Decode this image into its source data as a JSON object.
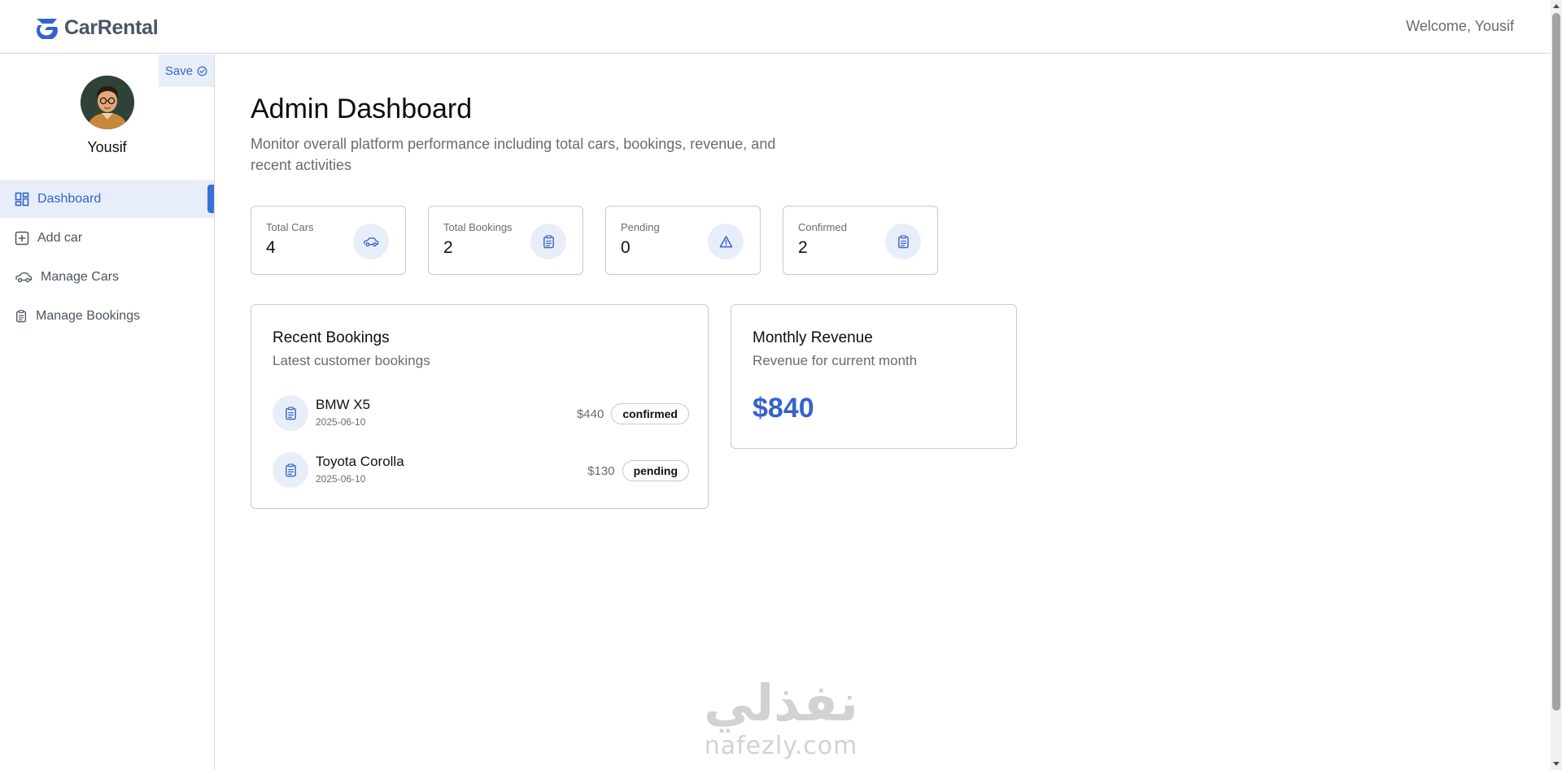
{
  "header": {
    "logo_text": "CarRental",
    "welcome": "Welcome, Yousif"
  },
  "sidebar": {
    "save_label": "Save",
    "user_name": "Yousif",
    "items": [
      {
        "label": "Dashboard",
        "icon": "dashboard-icon",
        "active": true
      },
      {
        "label": "Add car",
        "icon": "plus-square-icon",
        "active": false
      },
      {
        "label": "Manage Cars",
        "icon": "car-icon",
        "active": false
      },
      {
        "label": "Manage Bookings",
        "icon": "clipboard-icon",
        "active": false
      }
    ]
  },
  "main": {
    "title": "Admin Dashboard",
    "subtitle": "Monitor overall platform performance including total cars, bookings, revenue, and recent activities",
    "stats": [
      {
        "label": "Total Cars",
        "value": "4",
        "icon": "car-icon"
      },
      {
        "label": "Total Bookings",
        "value": "2",
        "icon": "clipboard-icon"
      },
      {
        "label": "Pending",
        "value": "0",
        "icon": "warning-icon"
      },
      {
        "label": "Confirmed",
        "value": "2",
        "icon": "clipboard-icon"
      }
    ],
    "recent_bookings": {
      "title": "Recent Bookings",
      "subtitle": "Latest customer bookings",
      "items": [
        {
          "car": "BMW X5",
          "date": "2025-06-10",
          "price": "$440",
          "status": "confirmed"
        },
        {
          "car": "Toyota Corolla",
          "date": "2025-06-10",
          "price": "$130",
          "status": "pending"
        }
      ]
    },
    "monthly_revenue": {
      "title": "Monthly Revenue",
      "subtitle": "Revenue for current month",
      "value": "$840"
    }
  },
  "watermark": {
    "arabic": "نفذلي",
    "latin": "nafezly.com"
  },
  "colors": {
    "accent": "#3563c9",
    "accent_light": "#e8eef9",
    "border": "#c9c9c9"
  }
}
